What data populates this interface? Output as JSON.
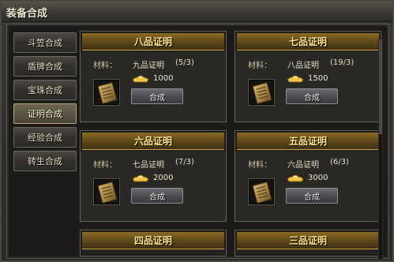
{
  "window": {
    "title": "装备合成"
  },
  "sidebar": {
    "items": [
      {
        "label": "斗笠合成",
        "active": false
      },
      {
        "label": "盾牌合成",
        "active": false
      },
      {
        "label": "宝珠合成",
        "active": false
      },
      {
        "label": "证明合成",
        "active": true
      },
      {
        "label": "经验合成",
        "active": false
      },
      {
        "label": "转生合成",
        "active": false
      }
    ]
  },
  "cards": [
    {
      "title": "八品证明",
      "material_label": "材料：",
      "material_name": "九品证明",
      "material_count": "(5/3)",
      "cost": "1000",
      "button": "合成",
      "item_icon": "scroll-icon",
      "cost_icon": "gold-ingot-icon"
    },
    {
      "title": "七品证明",
      "material_label": "材料：",
      "material_name": "八品证明",
      "material_count": "(19/3)",
      "cost": "1500",
      "button": "合成",
      "item_icon": "scroll-icon",
      "cost_icon": "gold-ingot-icon"
    },
    {
      "title": "六品证明",
      "material_label": "材料：",
      "material_name": "七品证明",
      "material_count": "(7/3)",
      "cost": "2000",
      "button": "合成",
      "item_icon": "scroll-icon",
      "cost_icon": "gold-ingot-icon"
    },
    {
      "title": "五品证明",
      "material_label": "材料：",
      "material_name": "六品证明",
      "material_count": "(6/3)",
      "cost": "3000",
      "button": "合成",
      "item_icon": "scroll-icon",
      "cost_icon": "gold-ingot-icon"
    },
    {
      "title": "四品证明"
    },
    {
      "title": "三品证明"
    }
  ]
}
